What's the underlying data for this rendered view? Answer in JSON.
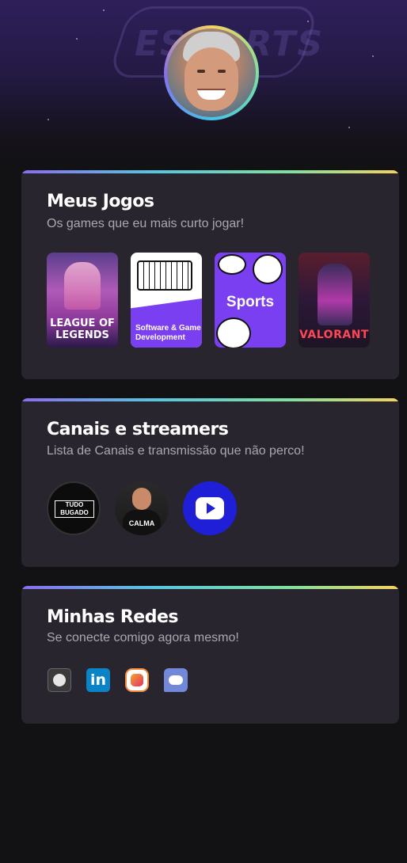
{
  "profile": {
    "avatar_alt": "Profile photo"
  },
  "hero": {
    "logo_text": "ESPORTS"
  },
  "games": {
    "title": "Meus Jogos",
    "subtitle": "Os games que eu mais curto jogar!",
    "items": [
      {
        "label": "LEAGUE OF LEGENDS"
      },
      {
        "label": "Software & Game Development"
      },
      {
        "label": "Sports"
      },
      {
        "label": "VALORANT"
      }
    ]
  },
  "channels": {
    "title": "Canais e streamers",
    "subtitle": "Lista de Canais e transmissão que não perco!",
    "items": [
      {
        "label": "TUDO BUGADO"
      },
      {
        "label": "CALMA"
      },
      {
        "label": ""
      }
    ]
  },
  "social": {
    "title": "Minhas Redes",
    "subtitle": "Se conecte comigo agora mesmo!",
    "items": [
      {
        "icon": "github-icon"
      },
      {
        "icon": "linkedin-icon",
        "glyph": "in"
      },
      {
        "icon": "instagram-icon"
      },
      {
        "icon": "discord-icon"
      }
    ]
  },
  "colors": {
    "background": "#121214",
    "card": "#29252f",
    "accent_gradient": [
      "#8a6cf0",
      "#57c6e0",
      "#7ee0a0",
      "#f4d35e"
    ]
  }
}
